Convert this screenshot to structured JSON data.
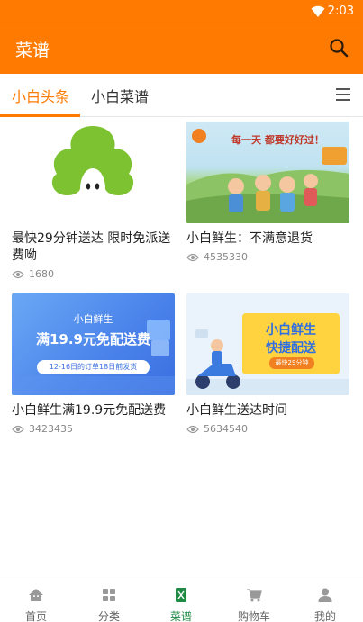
{
  "status_bar": {
    "time": "2:03"
  },
  "app_bar": {
    "title": "菜谱"
  },
  "tabs": [
    {
      "label": "小白头条",
      "active": true
    },
    {
      "label": "小白菜谱",
      "active": false
    }
  ],
  "articles": [
    {
      "title": "最快29分钟送达 限时免派送费呦",
      "views": "1680"
    },
    {
      "title": "小白鲜生：不满意退货",
      "views": "4535330"
    },
    {
      "title": "小白鲜生满19.9元免配送费",
      "views": "3423435"
    },
    {
      "title": "小白鲜生送达时间",
      "views": "5634540"
    }
  ],
  "banner_texts": {
    "b2_heading": "每一天 都要好好过！",
    "b3_brand": "小白鲜生",
    "b3_heading": "满19.9元免配送费",
    "b3_note": "12-16日的订单18日前发货",
    "b4_heading1": "小白鲜生",
    "b4_heading2": "快捷配送",
    "b4_note": "最快29分钟"
  },
  "bottom_nav": [
    {
      "label": "首页",
      "icon": "home-icon",
      "active": false
    },
    {
      "label": "分类",
      "icon": "grid-icon",
      "active": false
    },
    {
      "label": "菜谱",
      "icon": "recipe-book-icon",
      "active": true
    },
    {
      "label": "购物车",
      "icon": "cart-icon",
      "active": false
    },
    {
      "label": "我的",
      "icon": "user-icon",
      "active": false
    }
  ],
  "colors": {
    "brand_orange": "#ff7a00",
    "active_nav_green": "#1f8a43",
    "logo_green": "#7dc230"
  }
}
